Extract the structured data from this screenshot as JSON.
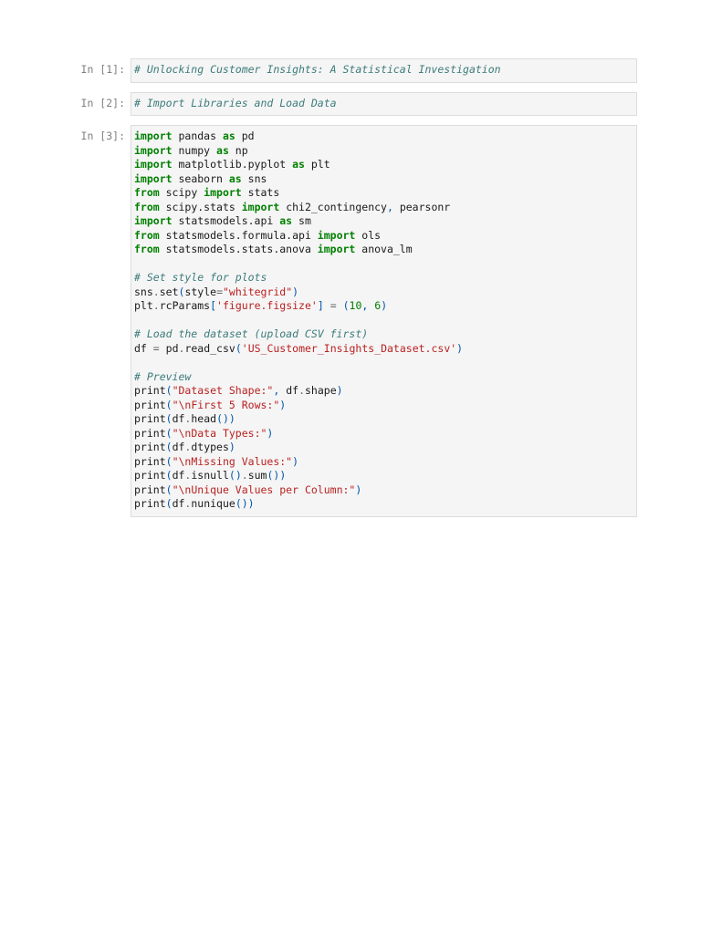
{
  "cells": [
    {
      "prompt": "In [1]:",
      "lines": [
        [
          {
            "t": "cm",
            "v": "# Unlocking Customer Insights: A Statistical Investigation"
          }
        ]
      ]
    },
    {
      "prompt": "In [2]:",
      "lines": [
        [
          {
            "t": "cm",
            "v": "# Import Libraries and Load Data"
          }
        ]
      ]
    },
    {
      "prompt": "In [3]:",
      "lines": [
        [
          {
            "t": "kw",
            "v": "import"
          },
          {
            "t": "tx",
            "v": " pandas "
          },
          {
            "t": "kw",
            "v": "as"
          },
          {
            "t": "tx",
            "v": " pd"
          }
        ],
        [
          {
            "t": "kw",
            "v": "import"
          },
          {
            "t": "tx",
            "v": " numpy "
          },
          {
            "t": "kw",
            "v": "as"
          },
          {
            "t": "tx",
            "v": " np"
          }
        ],
        [
          {
            "t": "kw",
            "v": "import"
          },
          {
            "t": "tx",
            "v": " matplotlib.pyplot "
          },
          {
            "t": "kw",
            "v": "as"
          },
          {
            "t": "tx",
            "v": " plt"
          }
        ],
        [
          {
            "t": "kw",
            "v": "import"
          },
          {
            "t": "tx",
            "v": " seaborn "
          },
          {
            "t": "kw",
            "v": "as"
          },
          {
            "t": "tx",
            "v": " sns"
          }
        ],
        [
          {
            "t": "kw",
            "v": "from"
          },
          {
            "t": "tx",
            "v": " scipy "
          },
          {
            "t": "kw",
            "v": "import"
          },
          {
            "t": "tx",
            "v": " stats"
          }
        ],
        [
          {
            "t": "kw",
            "v": "from"
          },
          {
            "t": "tx",
            "v": " scipy.stats "
          },
          {
            "t": "kw",
            "v": "import"
          },
          {
            "t": "tx",
            "v": " chi2_contingency"
          },
          {
            "t": "pn",
            "v": ","
          },
          {
            "t": "tx",
            "v": " pearsonr"
          }
        ],
        [
          {
            "t": "kw",
            "v": "import"
          },
          {
            "t": "tx",
            "v": " statsmodels.api "
          },
          {
            "t": "kw",
            "v": "as"
          },
          {
            "t": "tx",
            "v": " sm"
          }
        ],
        [
          {
            "t": "kw",
            "v": "from"
          },
          {
            "t": "tx",
            "v": " statsmodels.formula.api "
          },
          {
            "t": "kw",
            "v": "import"
          },
          {
            "t": "tx",
            "v": " ols"
          }
        ],
        [
          {
            "t": "kw",
            "v": "from"
          },
          {
            "t": "tx",
            "v": " statsmodels.stats.anova "
          },
          {
            "t": "kw",
            "v": "import"
          },
          {
            "t": "tx",
            "v": " anova_lm"
          }
        ],
        [],
        [
          {
            "t": "cm",
            "v": "# Set style for plots"
          }
        ],
        [
          {
            "t": "tx",
            "v": "sns"
          },
          {
            "t": "op",
            "v": "."
          },
          {
            "t": "tx",
            "v": "set"
          },
          {
            "t": "pn",
            "v": "("
          },
          {
            "t": "tx",
            "v": "style"
          },
          {
            "t": "op",
            "v": "="
          },
          {
            "t": "st",
            "v": "\"whitegrid\""
          },
          {
            "t": "pn",
            "v": ")"
          }
        ],
        [
          {
            "t": "tx",
            "v": "plt"
          },
          {
            "t": "op",
            "v": "."
          },
          {
            "t": "tx",
            "v": "rcParams"
          },
          {
            "t": "pn",
            "v": "["
          },
          {
            "t": "st",
            "v": "'figure.figsize'"
          },
          {
            "t": "pn",
            "v": "]"
          },
          {
            "t": "tx",
            "v": " "
          },
          {
            "t": "op",
            "v": "="
          },
          {
            "t": "tx",
            "v": " "
          },
          {
            "t": "pn",
            "v": "("
          },
          {
            "t": "nu",
            "v": "10"
          },
          {
            "t": "pn",
            "v": ","
          },
          {
            "t": "tx",
            "v": " "
          },
          {
            "t": "nu",
            "v": "6"
          },
          {
            "t": "pn",
            "v": ")"
          }
        ],
        [],
        [
          {
            "t": "cm",
            "v": "# Load the dataset (upload CSV first)"
          }
        ],
        [
          {
            "t": "tx",
            "v": "df "
          },
          {
            "t": "op",
            "v": "="
          },
          {
            "t": "tx",
            "v": " pd"
          },
          {
            "t": "op",
            "v": "."
          },
          {
            "t": "tx",
            "v": "read_csv"
          },
          {
            "t": "pn",
            "v": "("
          },
          {
            "t": "st",
            "v": "'US_Customer_Insights_Dataset.csv'"
          },
          {
            "t": "pn",
            "v": ")"
          }
        ],
        [],
        [
          {
            "t": "cm",
            "v": "# Preview"
          }
        ],
        [
          {
            "t": "tx",
            "v": "print"
          },
          {
            "t": "pn",
            "v": "("
          },
          {
            "t": "st",
            "v": "\"Dataset Shape:\""
          },
          {
            "t": "pn",
            "v": ","
          },
          {
            "t": "tx",
            "v": " df"
          },
          {
            "t": "op",
            "v": "."
          },
          {
            "t": "tx",
            "v": "shape"
          },
          {
            "t": "pn",
            "v": ")"
          }
        ],
        [
          {
            "t": "tx",
            "v": "print"
          },
          {
            "t": "pn",
            "v": "("
          },
          {
            "t": "st",
            "v": "\"\\nFirst 5 Rows:\""
          },
          {
            "t": "pn",
            "v": ")"
          }
        ],
        [
          {
            "t": "tx",
            "v": "print"
          },
          {
            "t": "pn",
            "v": "("
          },
          {
            "t": "tx",
            "v": "df"
          },
          {
            "t": "op",
            "v": "."
          },
          {
            "t": "tx",
            "v": "head"
          },
          {
            "t": "pn",
            "v": "())"
          }
        ],
        [
          {
            "t": "tx",
            "v": "print"
          },
          {
            "t": "pn",
            "v": "("
          },
          {
            "t": "st",
            "v": "\"\\nData Types:\""
          },
          {
            "t": "pn",
            "v": ")"
          }
        ],
        [
          {
            "t": "tx",
            "v": "print"
          },
          {
            "t": "pn",
            "v": "("
          },
          {
            "t": "tx",
            "v": "df"
          },
          {
            "t": "op",
            "v": "."
          },
          {
            "t": "tx",
            "v": "dtypes"
          },
          {
            "t": "pn",
            "v": ")"
          }
        ],
        [
          {
            "t": "tx",
            "v": "print"
          },
          {
            "t": "pn",
            "v": "("
          },
          {
            "t": "st",
            "v": "\"\\nMissing Values:\""
          },
          {
            "t": "pn",
            "v": ")"
          }
        ],
        [
          {
            "t": "tx",
            "v": "print"
          },
          {
            "t": "pn",
            "v": "("
          },
          {
            "t": "tx",
            "v": "df"
          },
          {
            "t": "op",
            "v": "."
          },
          {
            "t": "tx",
            "v": "isnull"
          },
          {
            "t": "pn",
            "v": "()"
          },
          {
            "t": "op",
            "v": "."
          },
          {
            "t": "tx",
            "v": "sum"
          },
          {
            "t": "pn",
            "v": "())"
          }
        ],
        [
          {
            "t": "tx",
            "v": "print"
          },
          {
            "t": "pn",
            "v": "("
          },
          {
            "t": "st",
            "v": "\"\\nUnique Values per Column:\""
          },
          {
            "t": "pn",
            "v": ")"
          }
        ],
        [
          {
            "t": "tx",
            "v": "print"
          },
          {
            "t": "pn",
            "v": "("
          },
          {
            "t": "tx",
            "v": "df"
          },
          {
            "t": "op",
            "v": "."
          },
          {
            "t": "tx",
            "v": "nunique"
          },
          {
            "t": "pn",
            "v": "())"
          }
        ]
      ]
    }
  ]
}
